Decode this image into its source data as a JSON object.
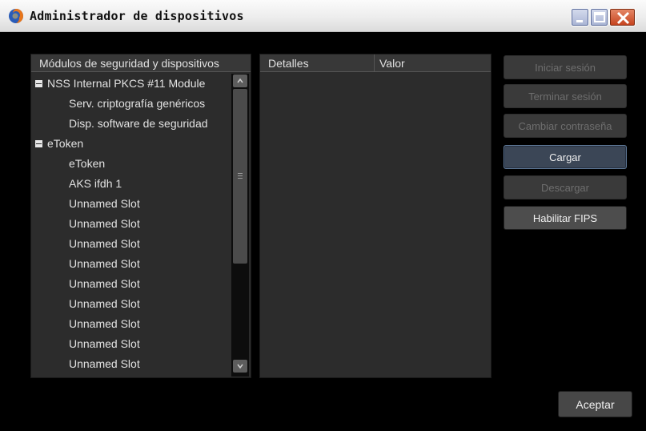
{
  "window": {
    "title": "Administrador de dispositivos",
    "controls": [
      "minimize-icon",
      "maximize-icon",
      "close-icon"
    ],
    "colors": {
      "background": "#000000",
      "panel": "#2c2c2c",
      "titlebar": "#ededed"
    }
  },
  "tree": {
    "header": "Módulos de seguridad y dispositivos",
    "rows": [
      {
        "label": "NSS Internal PKCS #11 Module",
        "level": 0,
        "expanded": true
      },
      {
        "label": "Serv. criptografía genéricos",
        "level": 1
      },
      {
        "label": "Disp. software de seguridad",
        "level": 1
      },
      {
        "label": "eToken",
        "level": 0,
        "expanded": true
      },
      {
        "label": "eToken",
        "level": 1
      },
      {
        "label": "AKS ifdh 1",
        "level": 1
      },
      {
        "label": "Unnamed Slot",
        "level": 1
      },
      {
        "label": "Unnamed Slot",
        "level": 1
      },
      {
        "label": "Unnamed Slot",
        "level": 1
      },
      {
        "label": "Unnamed Slot",
        "level": 1
      },
      {
        "label": "Unnamed Slot",
        "level": 1
      },
      {
        "label": "Unnamed Slot",
        "level": 1
      },
      {
        "label": "Unnamed Slot",
        "level": 1
      },
      {
        "label": "Unnamed Slot",
        "level": 1
      },
      {
        "label": "Unnamed Slot",
        "level": 1
      }
    ]
  },
  "details": {
    "columns": [
      "Detalles",
      "Valor"
    ]
  },
  "buttons": {
    "login": {
      "label": "Iniciar sesión",
      "enabled": false
    },
    "logout": {
      "label": "Terminar sesión",
      "enabled": false
    },
    "change_password": {
      "label": "Cambiar contraseña",
      "enabled": false
    },
    "load": {
      "label": "Cargar",
      "enabled": true,
      "focused": true
    },
    "unload": {
      "label": "Descargar",
      "enabled": false
    },
    "enable_fips": {
      "label": "Habilitar FIPS",
      "enabled": true
    },
    "ok": {
      "label": "Aceptar",
      "enabled": true
    }
  }
}
